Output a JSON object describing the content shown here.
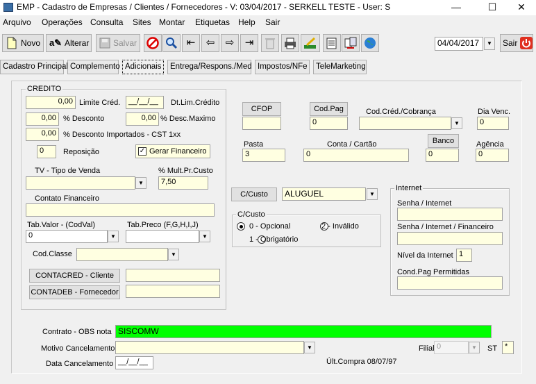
{
  "window": {
    "title": "EMP - Cadastro de Empresas / Clientes / Fornecedores - V: 03/04/2017 - SERKELL TESTE - User: S",
    "minimize": "—",
    "maximize": "☐",
    "close": "✕"
  },
  "menu": [
    "Arquivo",
    "Operações",
    "Consulta",
    "Sites",
    "Montar",
    "Etiquetas",
    "Help",
    "Sair"
  ],
  "toolbar": {
    "novo": "Novo",
    "alterar": "Alterar",
    "salvar": "Salvar",
    "date": "04/04/2017",
    "sair": "Sair"
  },
  "tabs": [
    "Cadastro Principal",
    "Complemento",
    "Adicionais",
    "Entrega/Respons./Med",
    "Impostos/NFe",
    "TeleMarketing"
  ],
  "credito": {
    "title": "CREDITO",
    "limite_value": "0,00",
    "limite_label": "Limite Créd.",
    "dt_lim_value": "__/__/__",
    "dt_lim_label": "Dt.Lim.Crédito",
    "desconto_value": "0,00",
    "desconto_label": "% Desconto",
    "desc_max_value": "0,00",
    "desc_max_label": "% Desc.Maximo",
    "desc_import_value": "0,00",
    "desc_import_label": "% Desconto Importados - CST 1xx",
    "reposicao_value": "0",
    "reposicao_label": "Reposição",
    "gerar_fin_label": "Gerar Financeiro",
    "gerar_fin_checked": "✓",
    "tv_label": "TV - Tipo de Venda",
    "tv_value": "",
    "mult_label": "% Mult.Pr.Custo",
    "mult_value": "7,50",
    "contato_label": "Contato Financeiro",
    "contato_value": "",
    "tabvalor_label": "Tab.Valor - (CodVal)",
    "tabvalor_value": "0",
    "tabpreco_label": "Tab.Preco (F,G,H,I,J)",
    "tabpreco_value": "",
    "codclasse_label": "Cod.Classe",
    "codclasse_value": "",
    "contacred_label": "CONTACRED - Cliente",
    "contacred_value": "",
    "contadeb_label": "CONTADEB - Fornecedor",
    "contadeb_value": ""
  },
  "fiscal": {
    "cfop_label": "CFOP",
    "cfop_value": "",
    "codpag_label": "Cod.Pag",
    "codpag_value": "0",
    "codcred_label": "Cod.Créd./Cobrança",
    "codcred_value": "",
    "diavenc_label": "Dia Venc.",
    "diavenc_value": "0",
    "pasta_label": "Pasta",
    "pasta_value": "3",
    "conta_label": "Conta / Cartão",
    "conta_value": "0",
    "banco_label": "Banco",
    "banco_value": "0",
    "agencia_label": "Agência",
    "agencia_value": "0"
  },
  "ccusto": {
    "button_label": "C/Custo",
    "value": "ALUGUEL",
    "group_title": "C/Custo",
    "opt0": "0 - Opcional",
    "opt1": "1 - Obrigatório",
    "opt2": "2 - Inválido"
  },
  "internet": {
    "title": "Internet",
    "senha_label": "Senha / Internet",
    "senha_value": "",
    "senha_fin_label": "Senha / Internet / Financeiro",
    "senha_fin_value": "",
    "nivel_label": "Nível da Internet",
    "nivel_value": "1",
    "codpag_label": "Cond.Pag Permitidas",
    "codpag_value": ""
  },
  "bottom": {
    "contrato_label": "Contrato - OBS nota",
    "contrato_value": "SISCOMW",
    "motivo_label": "Motivo Cancelamento",
    "motivo_value": "",
    "filial_label": "Filial",
    "filial_value": "0",
    "st_label": "ST",
    "st_value": "*",
    "data_canc_label": "Data Cancelamento",
    "data_canc_value": "__/__/__",
    "ult_compra": "Últ.Compra  08/07/97"
  },
  "colors": {
    "field_bg": "#ffffe1",
    "contrato_bg": "#00ff00"
  }
}
